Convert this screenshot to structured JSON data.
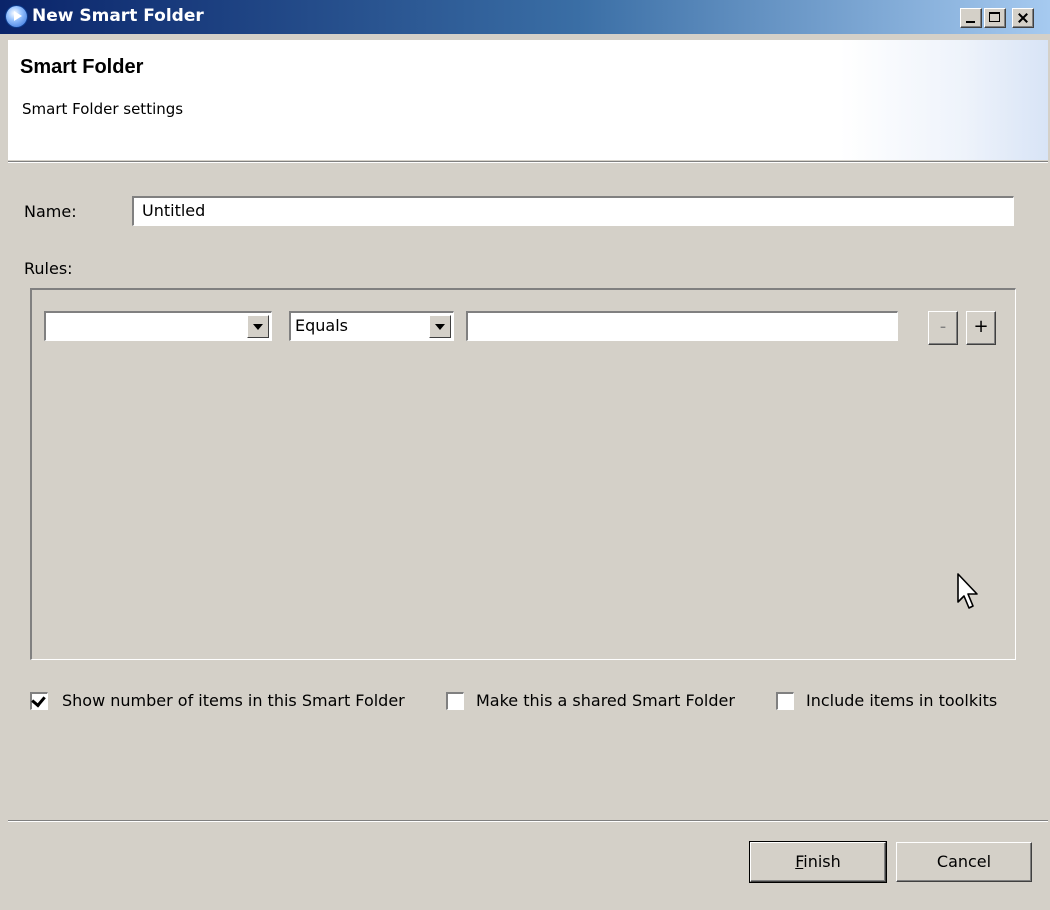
{
  "window": {
    "title": "New Smart Folder",
    "controls": {
      "minimize": "minimize-icon",
      "maximize": "maximize-icon",
      "close": "close-icon"
    }
  },
  "header": {
    "title": "Smart Folder",
    "subtitle": "Smart Folder settings"
  },
  "form": {
    "name_label": "Name:",
    "name_value": "Untitled",
    "rules_label": "Rules:",
    "rule": {
      "field_value": "",
      "operator_value": "Equals",
      "value": "",
      "remove_label": "-",
      "add_label": "+"
    }
  },
  "options": [
    {
      "label": "Show number of items in this Smart Folder",
      "checked": true
    },
    {
      "label": "Make this a shared Smart Folder",
      "checked": false
    },
    {
      "label": "Include items in toolkits",
      "checked": false
    }
  ],
  "buttons": {
    "finish_mnemonic": "F",
    "finish_rest": "inish",
    "cancel": "Cancel"
  },
  "colors": {
    "dialog_bg": "#d4d0c8",
    "titlebar_start": "#0a246a",
    "titlebar_end": "#a6caf0"
  }
}
